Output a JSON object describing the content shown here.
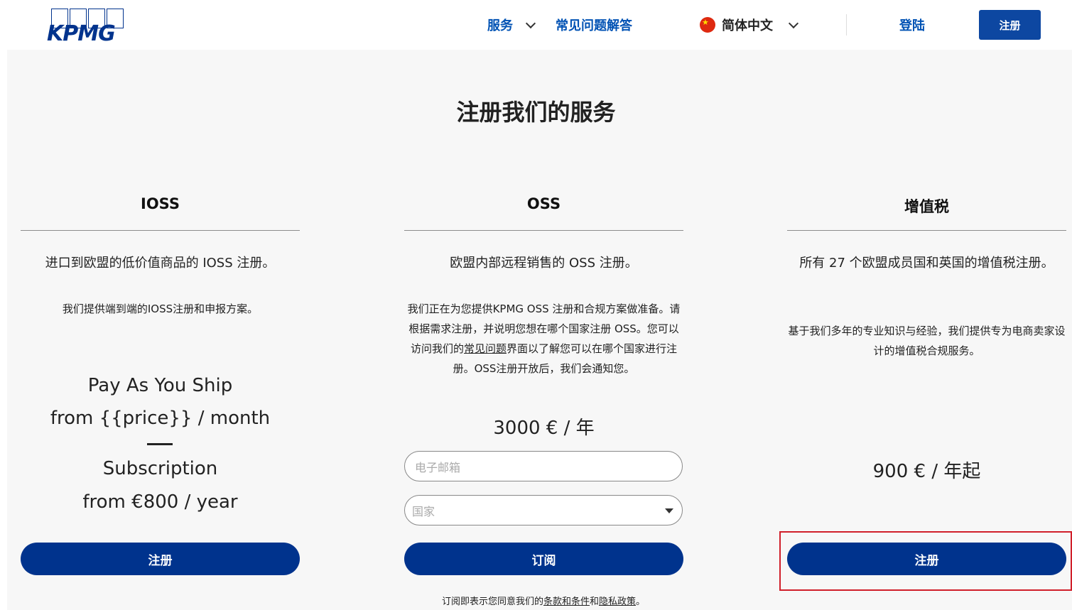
{
  "header": {
    "logo_text": "KPMG",
    "nav": {
      "services": "服务",
      "faq": "常见问题解答",
      "language": "简体中文",
      "login": "登陆",
      "register": "注册"
    }
  },
  "main": {
    "title": "注册我们的服务",
    "cards": [
      {
        "title": "IOSS",
        "desc": "进口到欧盟的低价值商品的 IOSS 注册。",
        "sub": "我们提供端到端的IOSS注册和申报方案。",
        "plan1": "Pay As You Ship",
        "plan1_price": "from {{price}} / month",
        "plan2": "Subscription",
        "plan2_price": "from €800 / year",
        "button": "注册"
      },
      {
        "title": "OSS",
        "desc": "欧盟内部远程销售的 OSS 注册。",
        "sub_part1": "我们正在为您提供KPMG OSS 注册和合规方案做准备。请根据需求注册，并说明您想在哪个国家注册 OSS。您可以访问我们的",
        "sub_link": "常见问题",
        "sub_part2": "界面以了解您可以在哪个国家进行注册。OSS注册开放后，我们会通知您。",
        "price": "3000 € / 年",
        "email_placeholder": "电子邮箱",
        "country_placeholder": "国家",
        "button": "订阅",
        "note_prefix": "订阅即表示您同意我们的",
        "note_terms": "条款和条件",
        "note_and": "和",
        "note_privacy": "隐私政策",
        "note_suffix": "。"
      },
      {
        "title": "增值税",
        "desc": "所有 27 个欧盟成员国和英国的增值税注册。",
        "sub": "基于我们多年的专业知识与经验，我们提供专为电商卖家设计的增值税合规服务。",
        "price": "900 € / 年起",
        "button": "注册"
      }
    ]
  },
  "colors": {
    "brand": "#00338d",
    "link": "#0052b4",
    "highlight": "#d01f2a"
  }
}
